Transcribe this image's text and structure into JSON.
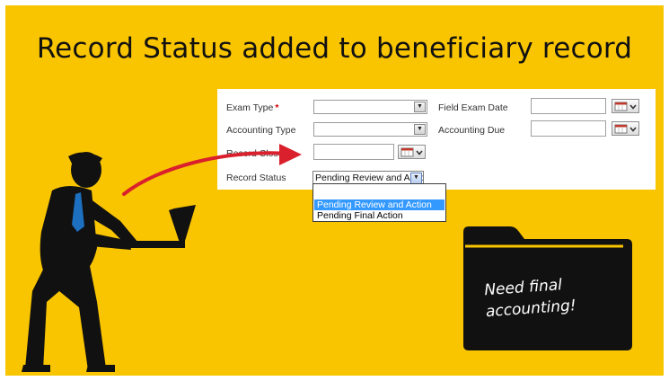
{
  "slide": {
    "title": "Record Status added to beneficiary record"
  },
  "form": {
    "exam_type": {
      "label": "Exam Type",
      "required_marker": "*",
      "value": ""
    },
    "field_exam_date": {
      "label": "Field Exam Date",
      "value": ""
    },
    "accounting_type": {
      "label": "Accounting Type",
      "value": ""
    },
    "accounting_due": {
      "label": "Accounting Due",
      "value": ""
    },
    "record_closed": {
      "label": "Record Closed",
      "value": ""
    },
    "record_status": {
      "label": "Record Status",
      "selected": "Pending Review and Action",
      "options": [
        "",
        "Pending Review and Action",
        "Pending Final Action"
      ],
      "highlighted_option": "Pending Review and Action"
    }
  },
  "folder_note": {
    "line1": "Need final",
    "line2": "accounting!"
  },
  "colors": {
    "background": "#f9c400",
    "figure": "#111111",
    "tie": "#1d6fc0",
    "arrow": "#d9202c",
    "highlight": "#3399ff"
  },
  "icons": [
    "calendar-icon",
    "chevron-down-icon"
  ]
}
